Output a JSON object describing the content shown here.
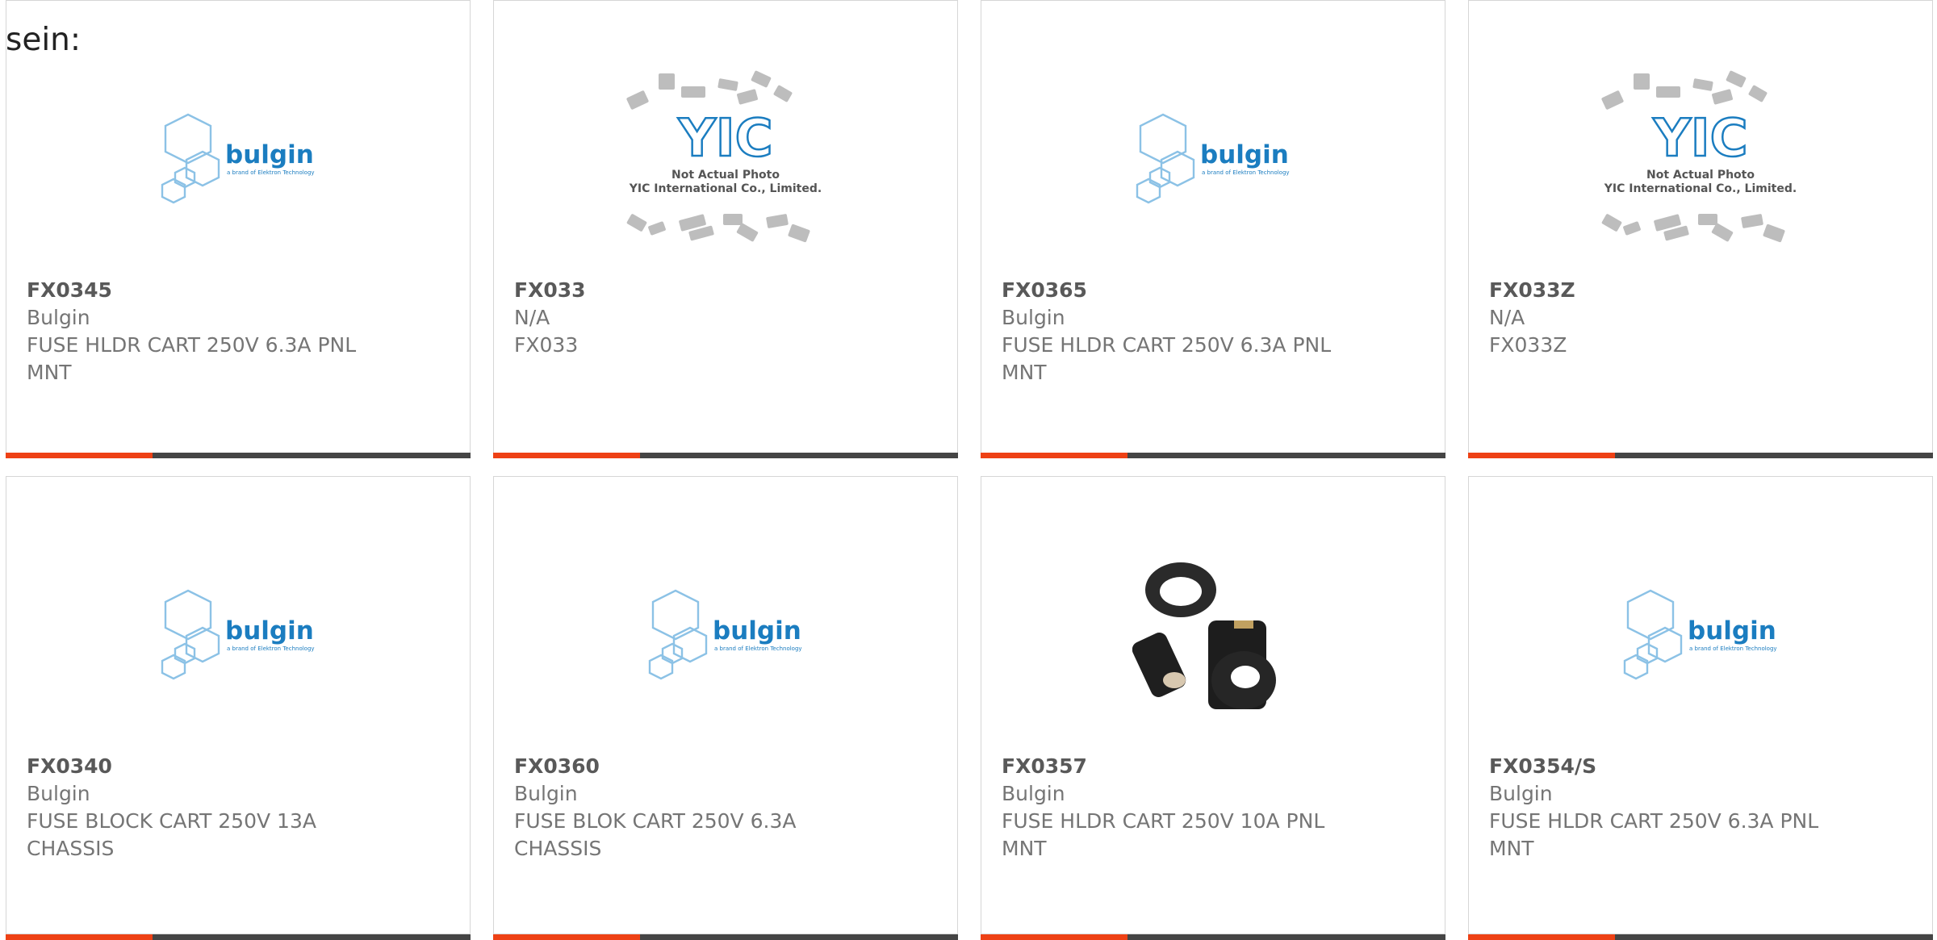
{
  "intro_text": "sein:",
  "colors": {
    "accent": "#ee4115",
    "bar": "#454545",
    "bulgin_blue": "#1b7dc0",
    "bulgin_light": "#8cc2e6"
  },
  "products": [
    {
      "part": "FX0345",
      "maker": "Bulgin",
      "desc1": "FUSE HLDR CART 250V 6.3A PNL",
      "desc2": "MNT",
      "image": "bulgin-logo-image",
      "logo": {
        "brand": "bulgin",
        "tagline": "a brand of Elektron Technology"
      }
    },
    {
      "part": "FX033",
      "maker": "N/A",
      "desc1": "FX033",
      "desc2": "",
      "image": "placeholder-image",
      "logo": {
        "mark": "YIC",
        "line1": "Not Actual Photo",
        "line2": "YIC International Co., Limited."
      }
    },
    {
      "part": "FX0365",
      "maker": "Bulgin",
      "desc1": "FUSE HLDR CART 250V 6.3A PNL",
      "desc2": "MNT",
      "image": "bulgin-logo-image",
      "logo": {
        "brand": "bulgin",
        "tagline": "a brand of Elektron Technology"
      }
    },
    {
      "part": "FX033Z",
      "maker": "N/A",
      "desc1": "FX033Z",
      "desc2": "",
      "image": "placeholder-image",
      "logo": {
        "mark": "YIC",
        "line1": "Not Actual Photo",
        "line2": "YIC International Co., Limited."
      }
    },
    {
      "part": "FX0340",
      "maker": "Bulgin",
      "desc1": "FUSE BLOCK CART 250V 13A",
      "desc2": "CHASSIS",
      "image": "bulgin-logo-image",
      "logo": {
        "brand": "bulgin",
        "tagline": "a brand of Elektron Technology"
      }
    },
    {
      "part": "FX0360",
      "maker": "Bulgin",
      "desc1": "FUSE BLOK CART 250V 6.3A",
      "desc2": "CHASSIS",
      "image": "bulgin-logo-image",
      "logo": {
        "brand": "bulgin",
        "tagline": "a brand of Elektron Technology"
      }
    },
    {
      "part": "FX0357",
      "maker": "Bulgin",
      "desc1": "FUSE HLDR CART 250V 10A PNL",
      "desc2": "MNT",
      "image": "fuse-holder-photo",
      "logo": {}
    },
    {
      "part": "FX0354/S",
      "maker": "Bulgin",
      "desc1": "FUSE HLDR CART 250V 6.3A PNL",
      "desc2": "MNT",
      "image": "bulgin-logo-image",
      "logo": {
        "brand": "bulgin",
        "tagline": "a brand of Elektron Technology"
      }
    }
  ]
}
